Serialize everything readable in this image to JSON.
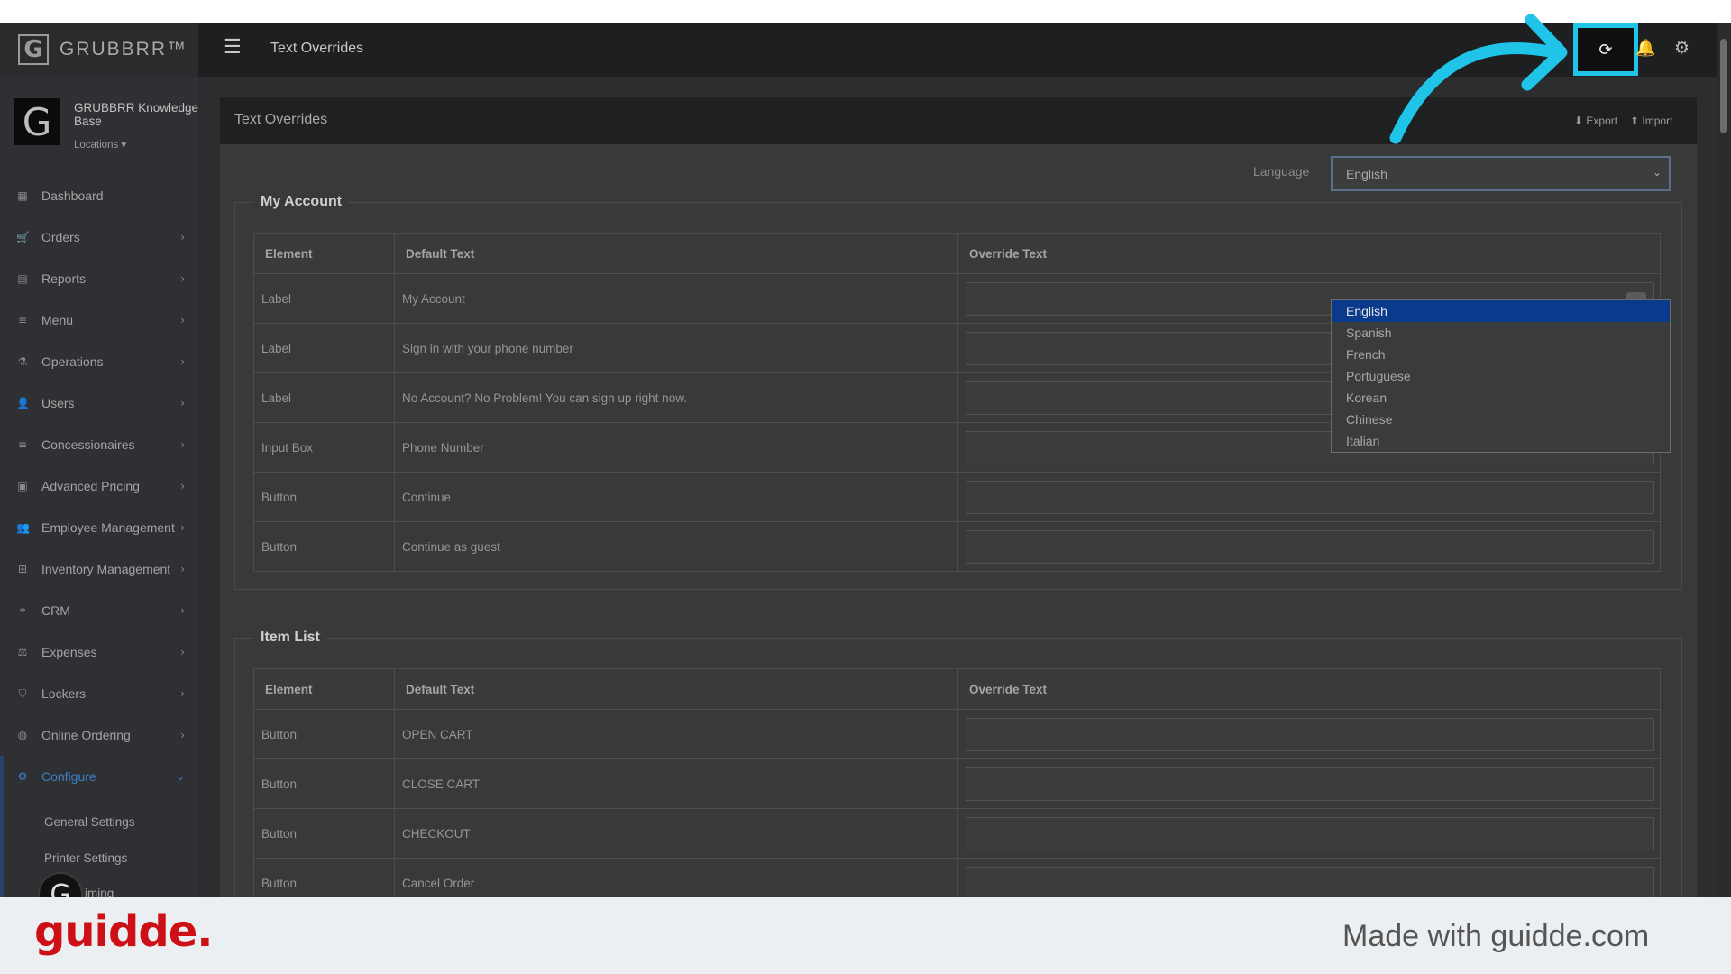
{
  "app": {
    "brand": "GRUBBRR™",
    "logo_letter": "G",
    "page_title": "Text Overrides"
  },
  "account": {
    "name": "GRUBBRR Knowledge Base",
    "locations_label": "Locations ▾"
  },
  "sidebar": {
    "items": [
      {
        "label": "Dashboard",
        "icon": "dashboard-icon",
        "glyph": "▦"
      },
      {
        "label": "Orders",
        "icon": "cart-icon",
        "glyph": "🛒"
      },
      {
        "label": "Reports",
        "icon": "report-icon",
        "glyph": "▤"
      },
      {
        "label": "Menu",
        "icon": "list-icon",
        "glyph": "≡"
      },
      {
        "label": "Operations",
        "icon": "flask-icon",
        "glyph": "⚗"
      },
      {
        "label": "Users",
        "icon": "user-plus-icon",
        "glyph": "👤"
      },
      {
        "label": "Concessionaires",
        "icon": "list-icon",
        "glyph": "≡"
      },
      {
        "label": "Advanced Pricing",
        "icon": "money-icon",
        "glyph": "▣"
      },
      {
        "label": "Employee Management",
        "icon": "users-icon",
        "glyph": "👥"
      },
      {
        "label": "Inventory Management",
        "icon": "sitemap-icon",
        "glyph": "⊞"
      },
      {
        "label": "CRM",
        "icon": "link-icon",
        "glyph": "⚭"
      },
      {
        "label": "Expenses",
        "icon": "balance-icon",
        "glyph": "⚖"
      },
      {
        "label": "Lockers",
        "icon": "locker-icon",
        "glyph": "⛉"
      },
      {
        "label": "Online Ordering",
        "icon": "globe-icon",
        "glyph": "◍"
      },
      {
        "label": "Configure",
        "icon": "cog-icon",
        "glyph": "⚙"
      }
    ],
    "sub_items": [
      "General Settings",
      "Printer Settings",
      "iming"
    ]
  },
  "panel": {
    "title": "Text Overrides",
    "export_label": "⬇ Export",
    "import_label": "⬆ Import",
    "language_label": "Language",
    "language_value": "English"
  },
  "table_headers": {
    "element": "Element",
    "default": "Default Text",
    "override": "Override Text"
  },
  "sections": [
    {
      "title": "My Account",
      "rows": [
        {
          "element": "Label",
          "default": "My Account"
        },
        {
          "element": "Label",
          "default": "Sign in with your phone number"
        },
        {
          "element": "Label",
          "default": "No Account? No Problem! You can sign up right now."
        },
        {
          "element": "Input Box",
          "default": "Phone Number"
        },
        {
          "element": "Button",
          "default": "Continue"
        },
        {
          "element": "Button",
          "default": "Continue as guest"
        }
      ]
    },
    {
      "title": "Item List",
      "rows": [
        {
          "element": "Button",
          "default": "OPEN CART"
        },
        {
          "element": "Button",
          "default": "CLOSE CART"
        },
        {
          "element": "Button",
          "default": "CHECKOUT"
        },
        {
          "element": "Button",
          "default": "Cancel Order"
        }
      ]
    }
  ],
  "language_options": [
    "English",
    "Spanish",
    "French",
    "Portuguese",
    "Korean",
    "Chinese",
    "Italian"
  ],
  "footer": {
    "logo": "guidde.",
    "text": "Made with guidde.com"
  },
  "colors": {
    "highlight": "#1fc4e8",
    "selected_option": "#0a3a8c",
    "accent": "#3c7fc4",
    "footer_logo": "#cc1015"
  }
}
